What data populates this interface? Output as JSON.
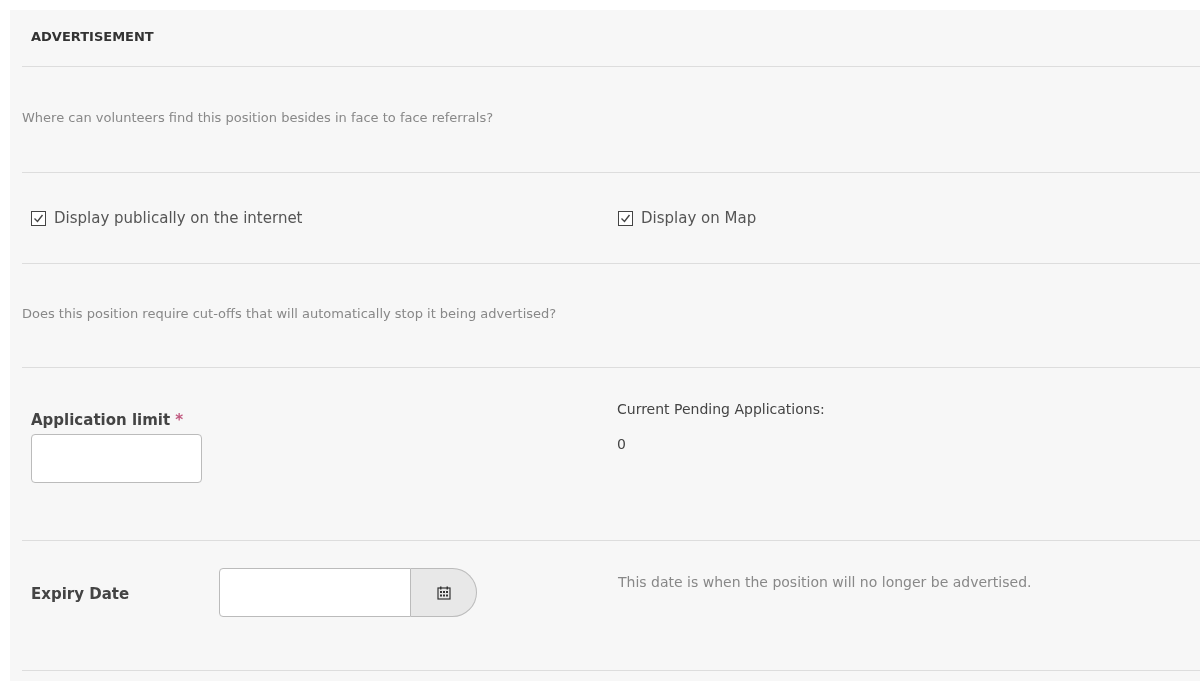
{
  "section": {
    "title": "ADVERTISEMENT"
  },
  "question_1": "Where can volunteers find this position besides in face to face referrals?",
  "checkboxes": [
    {
      "label": "Display publically on the internet",
      "checked": true
    },
    {
      "label": "Display on Map",
      "checked": true
    }
  ],
  "question_2": "Does this position require cut-offs that will automatically stop it being advertised?",
  "application_limit": {
    "label": "Application limit",
    "required_mark": "*"
  },
  "pending": {
    "label": "Current Pending Applications:",
    "value": "0"
  },
  "expiry_date": {
    "label": "Expiry Date",
    "help": "This date is when the position will no longer be advertised."
  }
}
